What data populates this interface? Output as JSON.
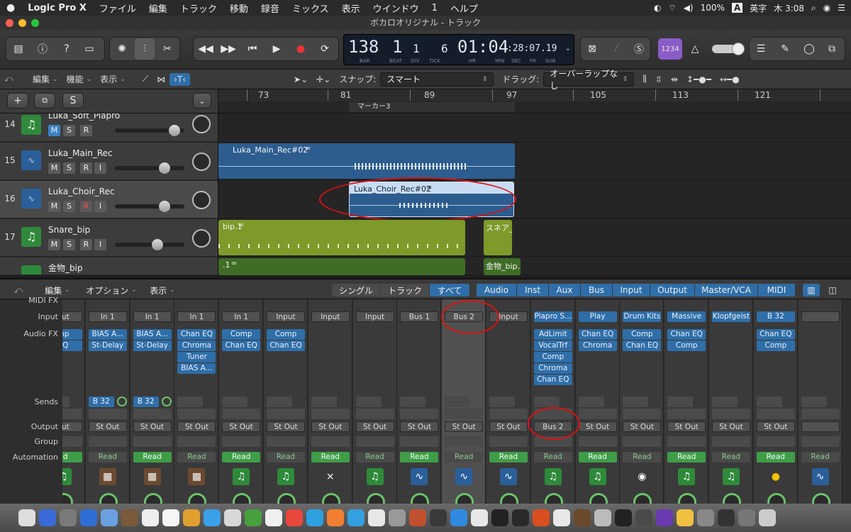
{
  "menubar": {
    "app": "Logic Pro X",
    "items": [
      "ファイル",
      "編集",
      "トラック",
      "移動",
      "録音",
      "ミックス",
      "表示",
      "ウインドウ",
      "1",
      "ヘルプ"
    ],
    "battery": "100%",
    "input_method": "英字",
    "clock": "木 3:08"
  },
  "window": {
    "title": "ボカロオリジナル - トラック"
  },
  "lcd": {
    "tempo": "138",
    "tempo_label": "BAR",
    "bar": "1",
    "bar_label": "BEAT",
    "beat": "1",
    "beat_label": "DIV",
    "div": "6",
    "div_label": "TICK",
    "time": "01:04",
    "time_small": ":28:07.19",
    "time_labels": [
      "HR",
      "MIN",
      "SEC",
      "FR",
      "SUB"
    ]
  },
  "toolbar": {
    "count_in": "1234"
  },
  "trackhdr": {
    "edit": "編集",
    "function": "機能",
    "view": "表示",
    "snap_label": "スナップ:",
    "snap_value": "スマート",
    "drag_label": "ドラッグ:",
    "drag_value": "オーバーラップなし"
  },
  "ruler": {
    "marks": [
      "73",
      "81",
      "89",
      "97",
      "105",
      "113",
      "121"
    ],
    "marker": "マーカー3"
  },
  "tracks": [
    {
      "num": "14",
      "name": "Luka_Soft_Piapro",
      "type": "inst",
      "buttons": [
        "M",
        "S",
        "R"
      ]
    },
    {
      "num": "15",
      "name": "Luka_Main_Rec",
      "type": "audio",
      "buttons": [
        "M",
        "S",
        "R",
        "I"
      ]
    },
    {
      "num": "16",
      "name": "Luka_Choir_Rec",
      "type": "audio",
      "buttons": [
        "M",
        "S",
        "R",
        "I"
      ]
    },
    {
      "num": "17",
      "name": "Snare_bip",
      "type": "inst",
      "buttons": [
        "M",
        "S",
        "R",
        "I"
      ]
    },
    {
      "num": "",
      "name": "金物_bip",
      "type": "inst",
      "buttons": []
    }
  ],
  "regions": {
    "luka_main": "Luka_Main_Rec#02",
    "luka_choir": "Luka_Choir_Rec#02",
    "snare": "bip.1",
    "snare2": "スネア_",
    "metal": ".1",
    "metal2": "金物_bip."
  },
  "mixer": {
    "header": {
      "edit": "編集",
      "options": "オプション",
      "view": "表示"
    },
    "tabs_left": [
      "シングル",
      "トラック",
      "すべて"
    ],
    "tabs_right": [
      "Audio",
      "Inst",
      "Aux",
      "Bus",
      "Input",
      "Output",
      "Master/VCA",
      "MIDI"
    ],
    "row_labels": {
      "midi_fx": "MIDI FX",
      "input": "Input",
      "audio_fx": "Audio FX",
      "sends": "Sends",
      "output": "Output",
      "group": "Group",
      "automation": "Automation"
    },
    "strips": [
      {
        "input": "put",
        "fx": [
          "mp",
          "EQ"
        ],
        "send": "",
        "output": "put",
        "auto": "ad",
        "icon": "inst"
      },
      {
        "input": "In 1",
        "fx": [
          "BIAS A...",
          "St-Delay"
        ],
        "send": "B 32",
        "output": "St Out",
        "auto": "Read",
        "icon": "amp"
      },
      {
        "input": "In 1",
        "fx": [
          "BIAS A...",
          "St-Delay"
        ],
        "send": "B 32",
        "output": "St Out",
        "auto": "Read",
        "icon": "amp"
      },
      {
        "input": "In 1",
        "fx": [
          "Chan EQ",
          "Chroma",
          "Tuner",
          "BIAS A..."
        ],
        "send": "",
        "output": "St Out",
        "auto": "Read",
        "icon": "amp"
      },
      {
        "input": "In 1",
        "fx": [
          "Comp",
          "Chan EQ"
        ],
        "send": "",
        "output": "St Out",
        "auto": "Read",
        "icon": "inst"
      },
      {
        "input": "Input",
        "fx": [
          "Comp",
          "Chan EQ"
        ],
        "send": "",
        "output": "St Out",
        "auto": "Read",
        "icon": "inst"
      },
      {
        "input": "Input",
        "fx": [],
        "send": "",
        "output": "St Out",
        "auto": "Read",
        "icon": "stand"
      },
      {
        "input": "Input",
        "fx": [],
        "send": "",
        "output": "St Out",
        "auto": "Read",
        "icon": "inst"
      },
      {
        "input": "Bus 1",
        "fx": [],
        "send": "",
        "output": "St Out",
        "auto": "Read",
        "icon": "audio"
      },
      {
        "input": "Bus 2",
        "fx": [],
        "send": "",
        "output": "St Out",
        "auto": "Read",
        "icon": "audio"
      },
      {
        "input": "Input",
        "fx": [],
        "send": "",
        "output": "St Out",
        "auto": "Read",
        "icon": "audio"
      },
      {
        "input": "Piapro S...",
        "fx": [
          "AdLimit",
          "VocalTrf",
          "Comp",
          "Chroma",
          "Chan EQ"
        ],
        "send": "",
        "output": "Bus 2",
        "auto": "Read",
        "icon": "inst"
      },
      {
        "input": "Play",
        "fx": [
          "Chan EQ",
          "Chroma"
        ],
        "send": "",
        "output": "St Out",
        "auto": "Read",
        "icon": "inst"
      },
      {
        "input": "Drum Kits",
        "fx": [
          "Comp",
          "Chan EQ"
        ],
        "send": "",
        "output": "St Out",
        "auto": "Read",
        "icon": "speaker"
      },
      {
        "input": "Massive",
        "fx": [
          "Chan EQ",
          "Comp"
        ],
        "send": "",
        "output": "St Out",
        "auto": "Read",
        "icon": "inst"
      },
      {
        "input": "Klopfgeist",
        "fx": [],
        "send": "",
        "output": "St Out",
        "auto": "Read",
        "icon": "inst"
      },
      {
        "input": "B 32",
        "fx": [
          "Chan EQ",
          "Comp"
        ],
        "send": "",
        "output": "St Out",
        "auto": "Read",
        "icon": "yellow"
      },
      {
        "input": "",
        "fx": [],
        "send": "",
        "output": "",
        "auto": "Read",
        "icon": "audio"
      }
    ]
  },
  "colors": {
    "audio_region": "#2d5d8f",
    "inst_region": "#7d9a2a",
    "green_region": "#3f6d26",
    "fx_slot": "#2f6ea8",
    "read": "#3f9d48",
    "annotation": "#d11111"
  }
}
